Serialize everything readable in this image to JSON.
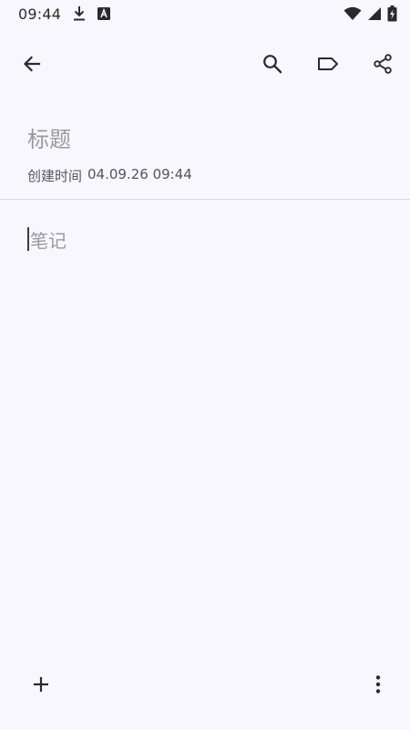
{
  "status_bar": {
    "time": "09:44",
    "icons": [
      "download-icon",
      "app-a-icon",
      "wifi-icon",
      "signal-icon",
      "battery-icon"
    ]
  },
  "toolbar": {
    "back_icon": "arrow-left-icon",
    "search_icon": "search-icon",
    "label_icon": "label-icon",
    "share_icon": "share-icon"
  },
  "editor": {
    "title_placeholder": "标题",
    "created_label": "创建时间",
    "created_time": "04.09.26 09:44",
    "note_placeholder": "笔记"
  },
  "bottom_bar": {
    "add_icon": "plus-icon",
    "more_icon": "more-vertical-icon"
  },
  "colors": {
    "background": "#f8f7fd",
    "icon": "#2a2a2e",
    "placeholder": "#9a99a0",
    "meta_text": "#55545a",
    "divider": "#d9d8dd"
  }
}
